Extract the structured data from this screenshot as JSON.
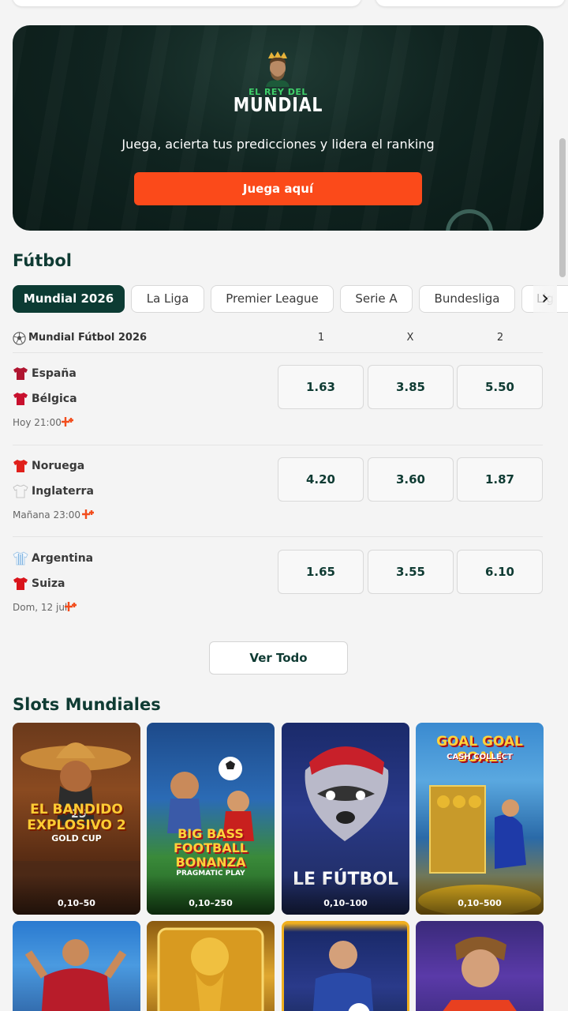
{
  "banner": {
    "logo_small": "EL REY DEL",
    "logo_big": "MUNDIAL",
    "tagline": "Juega, acierta tus predicciones y lidera el ranking",
    "cta": "Juega aquí"
  },
  "futbol": {
    "title": "Fútbol",
    "tabs": [
      "Mundial 2026",
      "La Liga",
      "Premier League",
      "Serie A",
      "Bundesliga",
      "Lig"
    ],
    "active_tab": "Mundial 2026",
    "league": "Mundial Fútbol 2026",
    "columns": [
      "1",
      "X",
      "2"
    ],
    "matches": [
      {
        "home": "España",
        "away": "Bélgica",
        "time": "Hoy 21:00",
        "odds": [
          "1.63",
          "3.85",
          "5.50"
        ]
      },
      {
        "home": "Noruega",
        "away": "Inglaterra",
        "time": "Mañana 23:00",
        "odds": [
          "4.20",
          "3.60",
          "1.87"
        ]
      },
      {
        "home": "Argentina",
        "away": "Suiza",
        "time": "Dom, 12 jul",
        "odds": [
          "1.65",
          "3.55",
          "6.10"
        ]
      }
    ],
    "view_all": "Ver Todo"
  },
  "slots": {
    "title": "Slots Mundiales",
    "games": [
      {
        "title": "EL BANDIDO EXPLOSIVO 2",
        "subtitle": "GOLD CUP",
        "range": "0,10–50"
      },
      {
        "title": "BIG BASS FOOTBALL BONANZA",
        "subtitle": "PRAGMATIC PLAY",
        "range": "0,10–250"
      },
      {
        "title": "LE FÚTBOL",
        "subtitle": "",
        "range": "0,10–100"
      },
      {
        "title": "GOAL GOAL GOAL!",
        "subtitle": "CASH COLLECT",
        "range": "0,10–500"
      }
    ]
  },
  "colors": {
    "brand_dark": "#0c3b33",
    "cta_orange": "#fb4a1a",
    "background": "#f4f4f4"
  }
}
